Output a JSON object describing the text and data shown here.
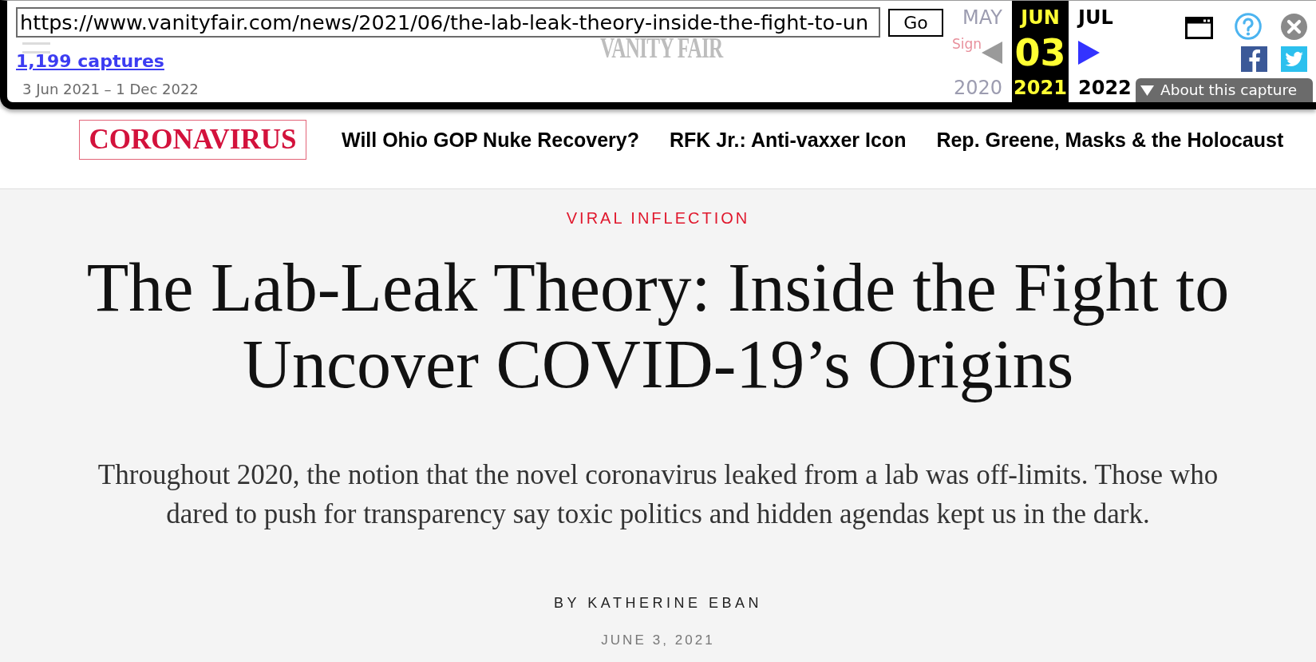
{
  "toolbar": {
    "url": "https://www.vanityfair.com/news/2021/06/the-lab-leak-theory-inside-the-fight-to-un",
    "go_button": "Go",
    "captures_link": "1,199 captures",
    "capture_range": "3 Jun 2021 – 1 Dec 2022",
    "calendar": [
      {
        "month": "MAY",
        "year": "2020",
        "selected": false,
        "disabled": true
      },
      {
        "month": "JUN",
        "day": "03",
        "year": "2021",
        "selected": true,
        "disabled": false
      },
      {
        "month": "JUL",
        "year": "2022",
        "selected": false,
        "disabled": false
      }
    ],
    "about_button": "About this capture"
  },
  "page_underlay": {
    "logo": "VANITY FAIR",
    "sign_in": "Sign"
  },
  "nav": {
    "section_label": "CORONAVIRUS",
    "links": [
      "Will Ohio GOP Nuke Recovery?",
      "RFK Jr.: Anti-vaxxer Icon",
      "Rep. Greene, Masks & the Holocaust"
    ]
  },
  "article": {
    "rubric": "VIRAL INFLECTION",
    "headline": "The Lab-Leak Theory: Inside the Fight to Uncover COVID-19’s Origins",
    "dek": "Throughout 2020, the notion that the novel coronavirus leaked from a lab was off-limits. Those who dared to push for transparency say toxic politics and hidden agendas kept us in the dark.",
    "byline": "BY KATHERINE EBAN",
    "date": "JUNE 3, 2021"
  }
}
